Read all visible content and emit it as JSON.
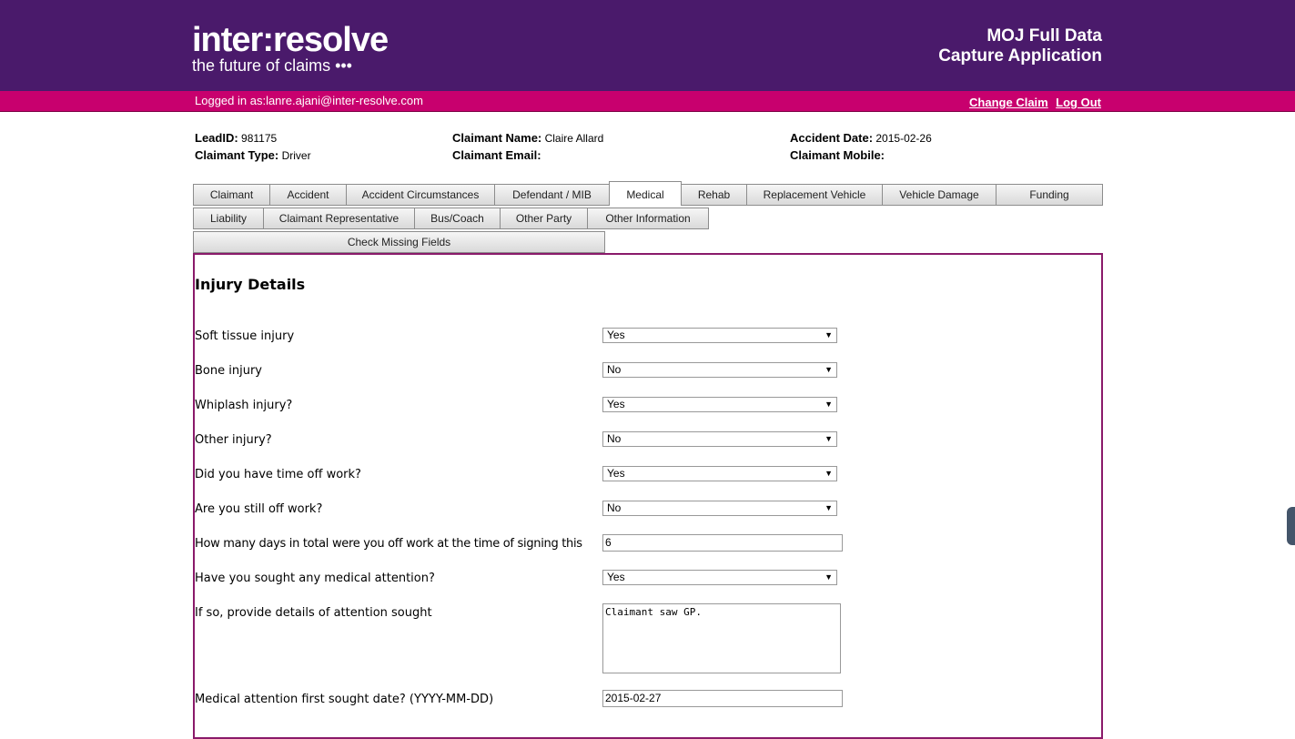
{
  "header": {
    "logo_main": "inter:resolve",
    "logo_tagline": "the future of claims •••",
    "title_line1": "MOJ Full Data",
    "title_line2": "Capture Application",
    "bg_color": "#4a1a6b"
  },
  "userbar": {
    "logged_in": "Logged in as:lanre.ajani@inter-resolve.com",
    "change_claim": "Change Claim",
    "log_out": "Log Out",
    "bg_color": "#c8006e"
  },
  "claim": {
    "lead_label": "LeadID:",
    "lead_value": "981175",
    "type_label": "Claimant Type:",
    "type_value": "Driver",
    "name_label": "Claimant Name:",
    "name_value": "Claire Allard",
    "email_label": "Claimant Email:",
    "email_value": "",
    "acc_label": "Accident Date:",
    "acc_value": "2015-02-26",
    "mobile_label": "Claimant Mobile:",
    "mobile_value": ""
  },
  "tabs_row1": [
    "Claimant",
    "Accident",
    "Accident Circumstances",
    "Defendant / MIB",
    "Medical",
    "Rehab",
    "Replacement Vehicle",
    "Vehicle Damage",
    "Funding"
  ],
  "tabs_row2": [
    "Liability",
    "Claimant Representative",
    "Bus/Coach",
    "Other Party",
    "Other Information"
  ],
  "tabs_row3": [
    "Check Missing Fields"
  ],
  "active_tab": "Medical",
  "form": {
    "section_title": "Injury Details",
    "fields": [
      {
        "label": "Soft tissue injury",
        "value": "Yes"
      },
      {
        "label": "Bone injury",
        "value": "No"
      },
      {
        "label": "Whiplash injury?",
        "value": "Yes"
      },
      {
        "label": "Other injury?",
        "value": "No"
      },
      {
        "label": "Did you have time off work?",
        "value": "Yes"
      },
      {
        "label": "Are you still off work?",
        "value": "No"
      },
      {
        "label": "How many days in total were you off work at the time of signing this",
        "value": "6"
      },
      {
        "label": "Have you sought any medical attention?",
        "value": "Yes"
      },
      {
        "label": "If so, provide details of attention sought",
        "value": "Claimant saw GP."
      },
      {
        "label": "Medical attention first sought date? (YYYY-MM-DD)",
        "value": "2015-02-27"
      }
    ]
  }
}
